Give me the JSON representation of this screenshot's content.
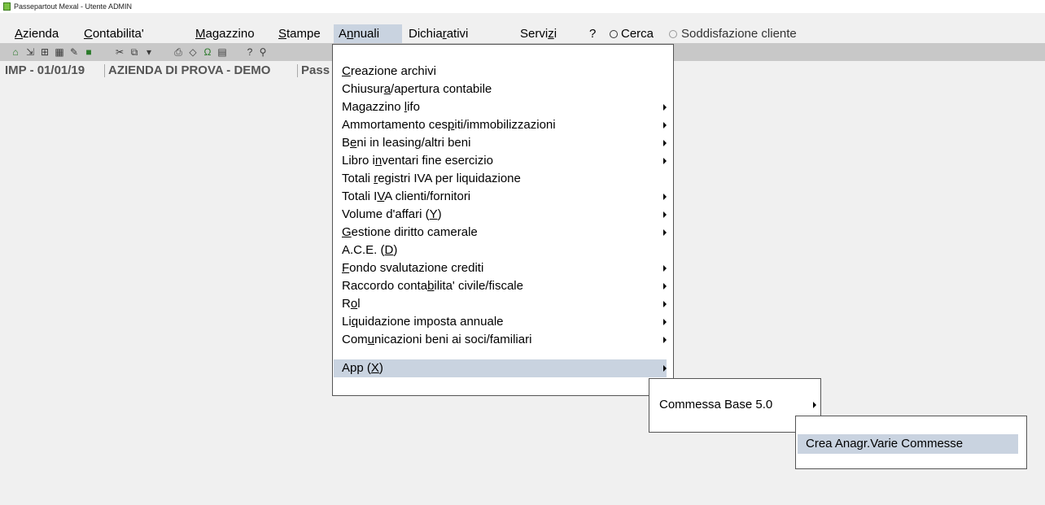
{
  "window": {
    "title": "Passepartout Mexal - Utente ADMIN"
  },
  "menubar": {
    "items": [
      {
        "label": "Azienda",
        "underline": "A"
      },
      {
        "label": "Contabilita'",
        "underline": "C"
      },
      {
        "label": "Magazzino",
        "underline": "M"
      },
      {
        "label": "Stampe",
        "underline": "S"
      },
      {
        "label": "Annuali",
        "underline": "n"
      },
      {
        "label": "Dichiarativi",
        "underline": "r"
      },
      {
        "label": "Servizi",
        "underline": "z"
      },
      {
        "label": "?"
      },
      {
        "label": "Cerca"
      },
      {
        "label": "Soddisfazione cliente"
      }
    ]
  },
  "infobar": {
    "company_code": "IMP - 01/01/19",
    "company_name": "AZIENDA DI PROVA - DEMO",
    "extra": "Pass"
  },
  "annuali_menu": {
    "items": [
      {
        "label": "Creazione archivi",
        "has_submenu": false
      },
      {
        "label": "Chiusura/apertura contabile",
        "has_submenu": false
      },
      {
        "label": "Magazzino lifo",
        "has_submenu": true
      },
      {
        "label": "Ammortamento cespiti/immobilizzazioni",
        "has_submenu": true
      },
      {
        "label": "Beni in leasing/altri beni",
        "has_submenu": true
      },
      {
        "label": "Libro inventari fine esercizio",
        "has_submenu": true
      },
      {
        "label": "Totali registri IVA per liquidazione",
        "has_submenu": false
      },
      {
        "label": "Totali IVA clienti/fornitori",
        "has_submenu": true
      },
      {
        "label": "Volume d'affari (Y)",
        "has_submenu": true
      },
      {
        "label": "Gestione diritto camerale",
        "has_submenu": true
      },
      {
        "label": "A.C.E. (D)",
        "has_submenu": false
      },
      {
        "label": "Fondo svalutazione crediti",
        "has_submenu": true
      },
      {
        "label": "Raccordo contabilita' civile/fiscale",
        "has_submenu": true
      },
      {
        "label": "Rol",
        "has_submenu": true
      },
      {
        "label": "Liquidazione imposta annuale",
        "has_submenu": true
      },
      {
        "label": "Comunicazioni beni ai soci/familiari",
        "has_submenu": true
      },
      {
        "label": "App (X)",
        "has_submenu": true,
        "highlighted": true
      }
    ]
  },
  "app_submenu": {
    "items": [
      {
        "label": "Commessa Base 5.0",
        "has_submenu": true
      }
    ]
  },
  "commessa_submenu": {
    "items": [
      {
        "label": "Crea Anagr.Varie Commesse",
        "highlighted": true
      }
    ]
  },
  "colors": {
    "menu_highlight": "#c9d3e0",
    "toolbar": "#c8c8c8",
    "background": "#f0f0f0"
  }
}
